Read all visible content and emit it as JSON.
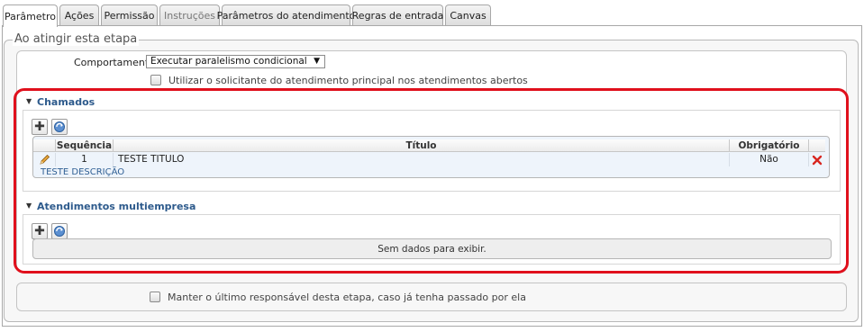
{
  "tabs": [
    {
      "label": "Parâmetro",
      "state": "active"
    },
    {
      "label": "Ações",
      "state": "normal"
    },
    {
      "label": "Permissão",
      "state": "normal"
    },
    {
      "label": "Instruções",
      "state": "disabled"
    },
    {
      "label": "Parâmetros do atendimento",
      "state": "normal"
    },
    {
      "label": "Regras de entrada",
      "state": "normal"
    },
    {
      "label": "Canvas",
      "state": "normal"
    }
  ],
  "stage": {
    "legend": "Ao atingir esta etapa",
    "behavior_label": "Comportamento :",
    "behavior_value": "Executar paralelismo condicional",
    "use_requester_label": "Utilizar o solicitante do atendimento principal nos atendimentos abertos",
    "use_requester_checked": false
  },
  "chamados": {
    "title": "Chamados",
    "columns": [
      "Sequência",
      "Título",
      "Obrigatório"
    ],
    "rows": [
      {
        "sequence": "1",
        "title": "TESTE TITULO",
        "required": "Não",
        "description": "TESTE DESCRIÇÃO"
      }
    ]
  },
  "multiempresa": {
    "title": "Atendimentos multiempresa",
    "empty_text": "Sem dados para exibir."
  },
  "keep_responsible": {
    "label": "Manter o último responsável desta etapa, caso já tenha passado por ela",
    "checked": false
  },
  "colors": {
    "highlight": "#e0101c",
    "section_title": "#2d5a8c",
    "row_bg": "#eef4fb",
    "delete_red": "#d8261f"
  },
  "icons": {
    "add": "plus-icon",
    "refresh": "refresh-icon",
    "edit": "pencil-icon",
    "delete": "delete-x-icon",
    "collapse": "caret-down-icon",
    "dropdown": "dropdown-arrow-icon"
  }
}
